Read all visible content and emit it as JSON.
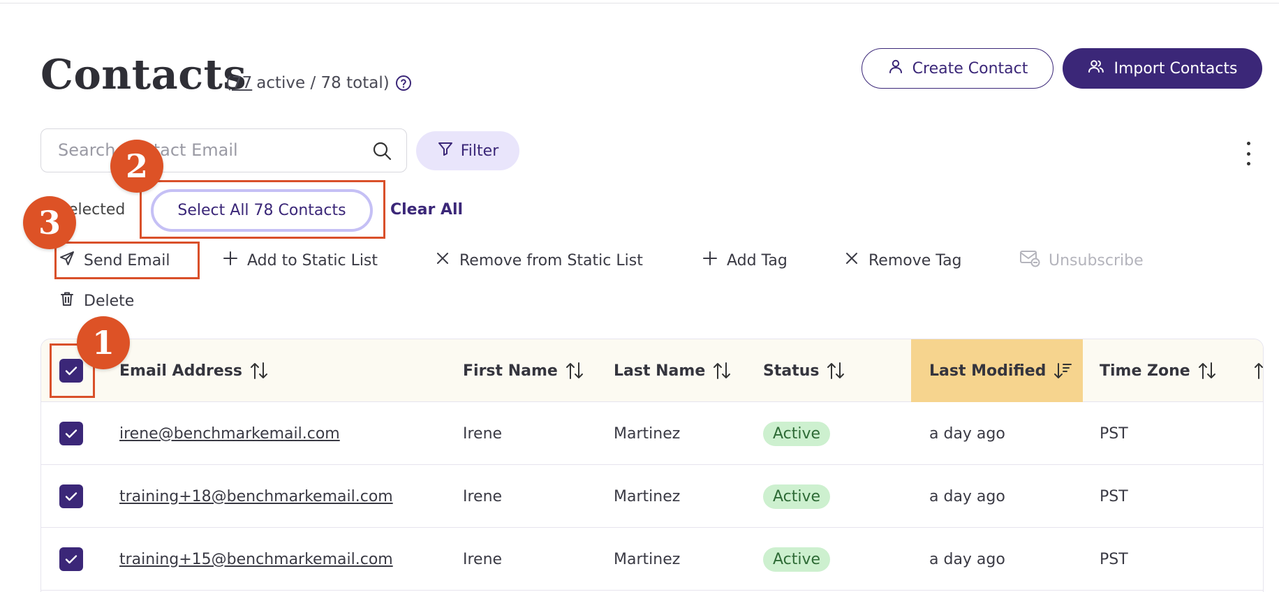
{
  "page": {
    "title": "Contacts",
    "counts": {
      "active_count": "77",
      "active_suffix": "active / 78 total)",
      "open_paren": "("
    }
  },
  "header_actions": {
    "create_label": "Create Contact",
    "import_label": "Import Contacts"
  },
  "search": {
    "placeholder": "Search Contact Email",
    "value": ""
  },
  "filter": {
    "label": "Filter"
  },
  "selection": {
    "selected_label": "Selected",
    "select_all_label": "Select All 78 Contacts",
    "clear_all_label": "Clear All"
  },
  "bulk_actions": {
    "send_email": "Send Email",
    "add_to_static_list": "Add to Static List",
    "remove_from_static_list": "Remove from Static List",
    "add_tag": "Add Tag",
    "remove_tag": "Remove Tag",
    "unsubscribe": "Unsubscribe",
    "delete": "Delete"
  },
  "annotations": {
    "badge_1": "1",
    "badge_2": "2",
    "badge_3": "3"
  },
  "table": {
    "columns": {
      "email": "Email Address",
      "first_name": "First Name",
      "last_name": "Last Name",
      "status": "Status",
      "last_modified": "Last Modified",
      "time_zone": "Time Zone"
    },
    "rows": [
      {
        "email": "irene@benchmarkemail.com",
        "first_name": "Irene",
        "last_name": "Martinez",
        "status": "Active",
        "last_modified": "a day ago",
        "time_zone": "PST",
        "checked": true
      },
      {
        "email": "training+18@benchmarkemail.com",
        "first_name": "Irene",
        "last_name": "Martinez",
        "status": "Active",
        "last_modified": "a day ago",
        "time_zone": "PST",
        "checked": true
      },
      {
        "email": "training+15@benchmarkemail.com",
        "first_name": "Irene",
        "last_name": "Martinez",
        "status": "Active",
        "last_modified": "a day ago",
        "time_zone": "PST",
        "checked": true
      }
    ]
  },
  "colors": {
    "brand": "#3b2778",
    "annotation": "#dd5226",
    "sorted_header": "#f6d48e",
    "status_active_bg": "#cdf0cf",
    "filter_bg": "#e9e5fb"
  }
}
